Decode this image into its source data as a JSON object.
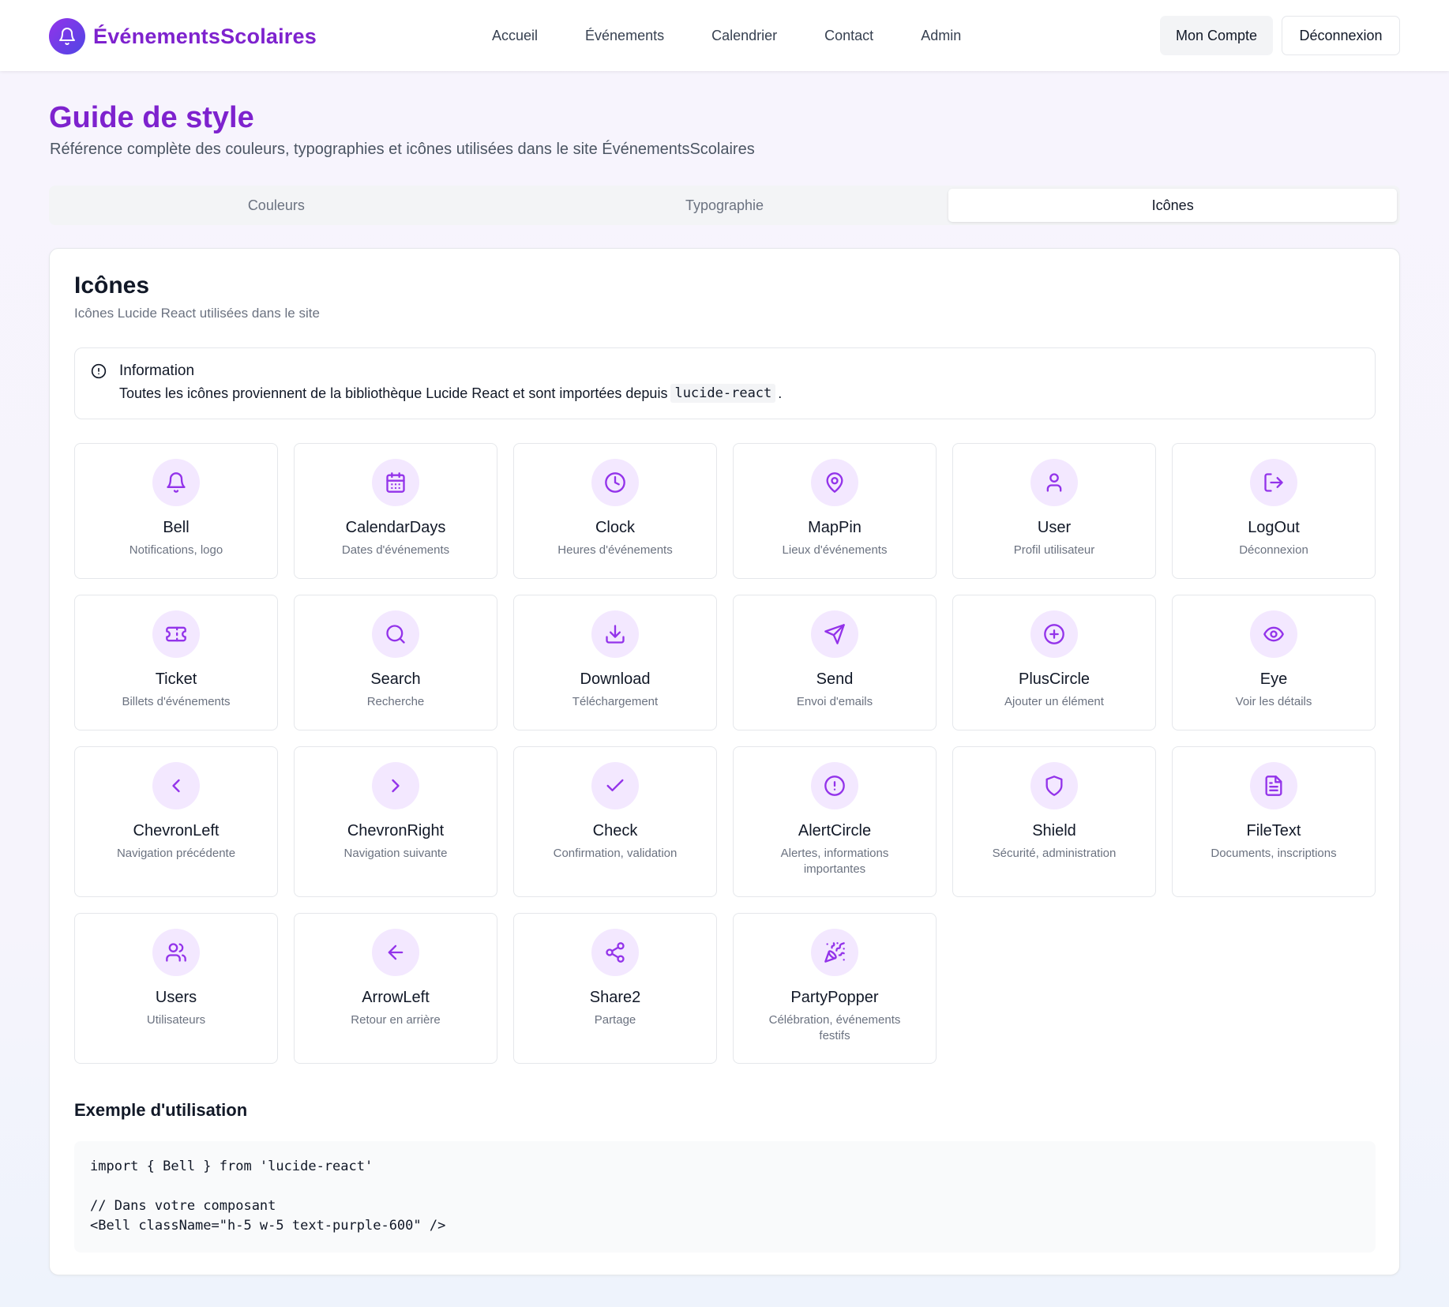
{
  "header": {
    "brand": "ÉvénementsScolaires",
    "nav": [
      "Accueil",
      "Événements",
      "Calendrier",
      "Contact",
      "Admin"
    ],
    "account_label": "Mon Compte",
    "logout_label": "Déconnexion"
  },
  "page": {
    "title": "Guide de style",
    "subtitle": "Référence complète des couleurs, typographies et icônes utilisées dans le site ÉvénementsScolaires"
  },
  "tabs": [
    {
      "label": "Couleurs",
      "active": false
    },
    {
      "label": "Typographie",
      "active": false
    },
    {
      "label": "Icônes",
      "active": true
    }
  ],
  "card": {
    "title": "Icônes",
    "description": "Icônes Lucide React utilisées dans le site"
  },
  "alert": {
    "title": "Information",
    "text": "Toutes les icônes proviennent de la bibliothèque Lucide React et sont importées depuis",
    "code": "lucide-react",
    "suffix": "."
  },
  "icons": [
    {
      "name": "Bell",
      "desc": "Notifications, logo",
      "icon": "bell-icon"
    },
    {
      "name": "CalendarDays",
      "desc": "Dates d'événements",
      "icon": "calendar-days-icon"
    },
    {
      "name": "Clock",
      "desc": "Heures d'événements",
      "icon": "clock-icon"
    },
    {
      "name": "MapPin",
      "desc": "Lieux d'événements",
      "icon": "map-pin-icon"
    },
    {
      "name": "User",
      "desc": "Profil utilisateur",
      "icon": "user-icon"
    },
    {
      "name": "LogOut",
      "desc": "Déconnexion",
      "icon": "log-out-icon"
    },
    {
      "name": "Ticket",
      "desc": "Billets d'événements",
      "icon": "ticket-icon"
    },
    {
      "name": "Search",
      "desc": "Recherche",
      "icon": "search-icon"
    },
    {
      "name": "Download",
      "desc": "Téléchargement",
      "icon": "download-icon"
    },
    {
      "name": "Send",
      "desc": "Envoi d'emails",
      "icon": "send-icon"
    },
    {
      "name": "PlusCircle",
      "desc": "Ajouter un élément",
      "icon": "plus-circle-icon"
    },
    {
      "name": "Eye",
      "desc": "Voir les détails",
      "icon": "eye-icon"
    },
    {
      "name": "ChevronLeft",
      "desc": "Navigation précédente",
      "icon": "chevron-left-icon"
    },
    {
      "name": "ChevronRight",
      "desc": "Navigation suivante",
      "icon": "chevron-right-icon"
    },
    {
      "name": "Check",
      "desc": "Confirmation, validation",
      "icon": "check-icon"
    },
    {
      "name": "AlertCircle",
      "desc": "Alertes, informations importantes",
      "icon": "alert-circle-icon"
    },
    {
      "name": "Shield",
      "desc": "Sécurité, administration",
      "icon": "shield-icon"
    },
    {
      "name": "FileText",
      "desc": "Documents, inscriptions",
      "icon": "file-text-icon"
    },
    {
      "name": "Users",
      "desc": "Utilisateurs",
      "icon": "users-icon"
    },
    {
      "name": "ArrowLeft",
      "desc": "Retour en arrière",
      "icon": "arrow-left-icon"
    },
    {
      "name": "Share2",
      "desc": "Partage",
      "icon": "share-icon"
    },
    {
      "name": "PartyPopper",
      "desc": "Célébration, événements festifs",
      "icon": "party-popper-icon"
    }
  ],
  "example": {
    "title": "Exemple d'utilisation",
    "code": "import { Bell } from 'lucide-react'\n\n// Dans votre composant\n<Bell className=\"h-5 w-5 text-purple-600\" />"
  },
  "colors": {
    "brand_purple": "#7e22ce",
    "icon_purple": "#9333ea",
    "icon_bg": "#f3e8ff"
  }
}
